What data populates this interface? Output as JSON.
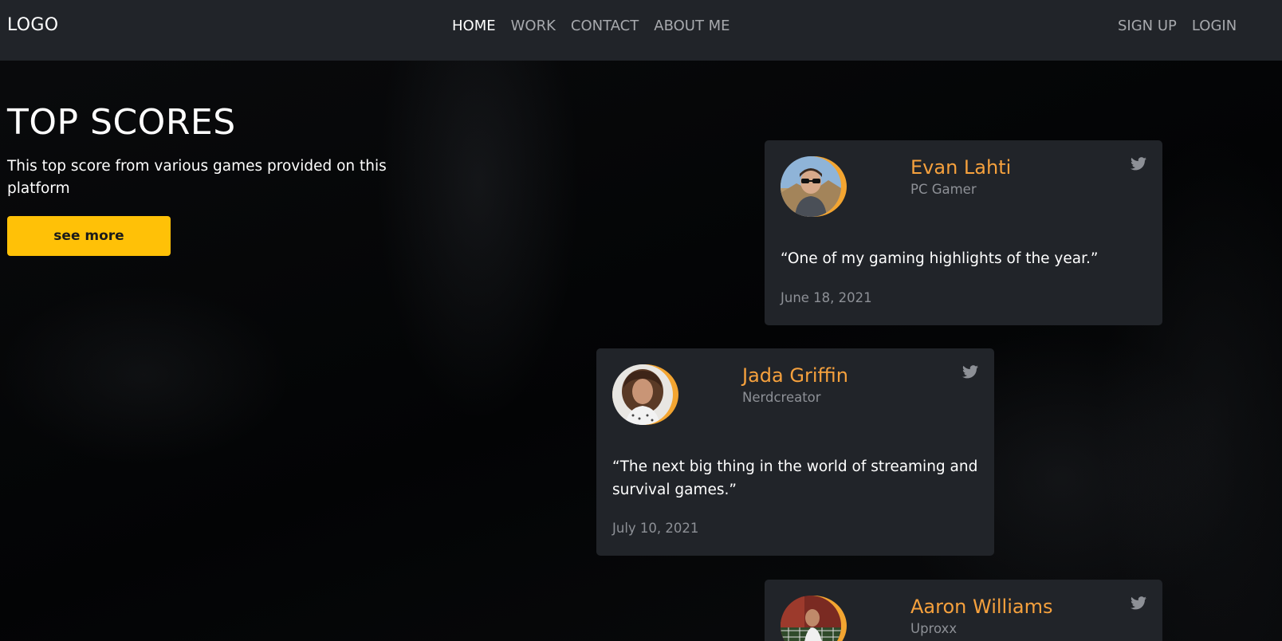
{
  "nav": {
    "logo": "LOGO",
    "links": [
      {
        "label": "HOME",
        "active": true
      },
      {
        "label": "WORK",
        "active": false
      },
      {
        "label": "CONTACT",
        "active": false
      },
      {
        "label": "ABOUT ME",
        "active": false
      }
    ],
    "auth": {
      "signup": "SIGN UP",
      "login": "LOGIN"
    }
  },
  "hero": {
    "title": "TOP SCORES",
    "subtitle": "This top score from various games provided on this platform",
    "button_label": "see more"
  },
  "cards": [
    {
      "name": "Evan Lahti",
      "role": "PC Gamer",
      "quote": "“One of my gaming highlights of the year.”",
      "date": "June 18, 2021",
      "icon": "twitter-icon"
    },
    {
      "name": "Jada Griffin",
      "role": "Nerdcreator",
      "quote": "“The next big thing in the world of streaming and survival games.”",
      "date": "July 10, 2021",
      "icon": "twitter-icon"
    },
    {
      "name": "Aaron Williams",
      "role": "Uproxx",
      "quote": "",
      "date": "",
      "icon": "twitter-icon"
    }
  ],
  "colors": {
    "navbar_bg": "#212429",
    "card_bg": "#212429",
    "accent": "#ffc107",
    "name_color": "#f6a13d",
    "avatar_ring": "#f3a531",
    "muted_text": "#8d9096"
  }
}
